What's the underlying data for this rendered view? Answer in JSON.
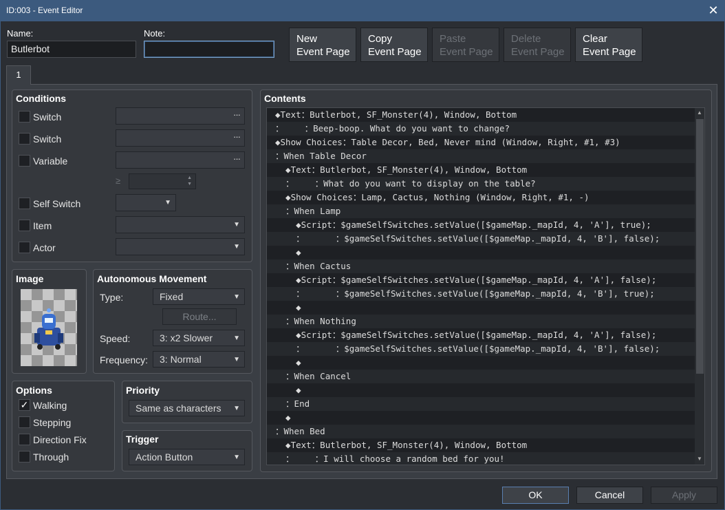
{
  "window": {
    "title": "ID:003 - Event Editor",
    "close": "✕"
  },
  "header": {
    "name_label": "Name:",
    "name_value": "Butlerbot",
    "note_label": "Note:",
    "note_value": "",
    "buttons": [
      {
        "label": "New\nEvent Page",
        "enabled": true
      },
      {
        "label": "Copy\nEvent Page",
        "enabled": true
      },
      {
        "label": "Paste\nEvent Page",
        "enabled": false
      },
      {
        "label": "Delete\nEvent Page",
        "enabled": false
      },
      {
        "label": "Clear\nEvent Page",
        "enabled": true
      }
    ]
  },
  "tabs": [
    "1"
  ],
  "conditions": {
    "title": "Conditions",
    "switch1": "Switch",
    "switch2": "Switch",
    "variable": "Variable",
    "gte": "≥",
    "self_switch": "Self Switch",
    "item": "Item",
    "actor": "Actor",
    "dots": "···"
  },
  "image": {
    "title": "Image"
  },
  "movement": {
    "title": "Autonomous Movement",
    "type_label": "Type:",
    "type_value": "Fixed",
    "route_label": "Route...",
    "speed_label": "Speed:",
    "speed_value": "3: x2 Slower",
    "freq_label": "Frequency:",
    "freq_value": "3: Normal"
  },
  "options": {
    "title": "Options",
    "walking": "Walking",
    "stepping": "Stepping",
    "direction_fix": "Direction Fix",
    "through": "Through",
    "checked_mark": "✓"
  },
  "priority": {
    "title": "Priority",
    "value": "Same as characters"
  },
  "trigger": {
    "title": "Trigger",
    "value": "Action Button"
  },
  "contents": {
    "title": "Contents",
    "lines": [
      "◆Text：Butlerbot, SF_Monster(4), Window, Bottom",
      "：    ：Beep-boop. What do you want to change?",
      "◆Show Choices：Table Decor, Bed, Never mind (Window, Right, #1, #3)",
      "：When Table Decor",
      "  ◆Text：Butlerbot, SF_Monster(4), Window, Bottom",
      "  ：    ：What do you want to display on the table?",
      "  ◆Show Choices：Lamp, Cactus, Nothing (Window, Right, #1, -)",
      "  ：When Lamp",
      "    ◆Script：$gameSelfSwitches.setValue([$gameMap._mapId, 4, 'A'], true);",
      "    ：      ：$gameSelfSwitches.setValue([$gameMap._mapId, 4, 'B'], false);",
      "    ◆",
      "  ：When Cactus",
      "    ◆Script：$gameSelfSwitches.setValue([$gameMap._mapId, 4, 'A'], false);",
      "    ：      ：$gameSelfSwitches.setValue([$gameMap._mapId, 4, 'B'], true);",
      "    ◆",
      "  ：When Nothing",
      "    ◆Script：$gameSelfSwitches.setValue([$gameMap._mapId, 4, 'A'], false);",
      "    ：      ：$gameSelfSwitches.setValue([$gameMap._mapId, 4, 'B'], false);",
      "    ◆",
      "  ：When Cancel",
      "    ◆",
      "  ：End",
      "  ◆",
      "：When Bed",
      "  ◆Text：Butlerbot, SF_Monster(4), Window, Bottom",
      "  ：    ：I will choose a random bed for you!"
    ]
  },
  "footer": {
    "ok": "OK",
    "cancel": "Cancel",
    "apply": "Apply"
  }
}
